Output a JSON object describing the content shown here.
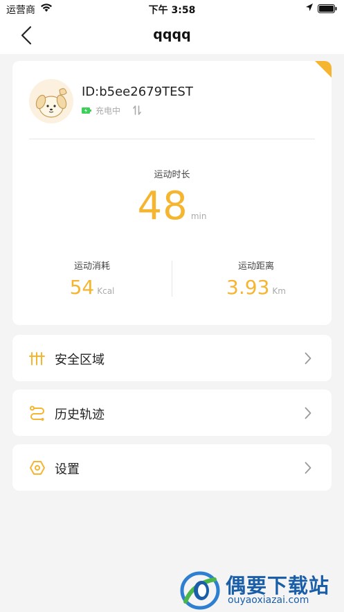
{
  "status_bar": {
    "carrier": "运营商",
    "time": "下午 3:58"
  },
  "nav": {
    "title": "qqqq"
  },
  "device": {
    "id": "ID:b5ee2679TEST",
    "charging_status": "充电中"
  },
  "activity": {
    "duration_label": "运动时长",
    "duration_value": "48",
    "duration_unit": "min",
    "calories_label": "运动消耗",
    "calories_value": "54",
    "calories_unit": "Kcal",
    "distance_label": "运动距离",
    "distance_value": "3.93",
    "distance_unit": "Km"
  },
  "menu": [
    {
      "label": "安全区域",
      "icon": "safe-zone-icon"
    },
    {
      "label": "历史轨迹",
      "icon": "history-track-icon"
    },
    {
      "label": "设置",
      "icon": "settings-hexagon-icon"
    }
  ],
  "watermark": {
    "title": "偶要下载站",
    "url": "ouyaoxiazai.com"
  },
  "colors": {
    "accent": "#f6b531",
    "background": "#f4f4f4",
    "charging": "#3ecf5a",
    "watermark": "#1a5ea8"
  }
}
